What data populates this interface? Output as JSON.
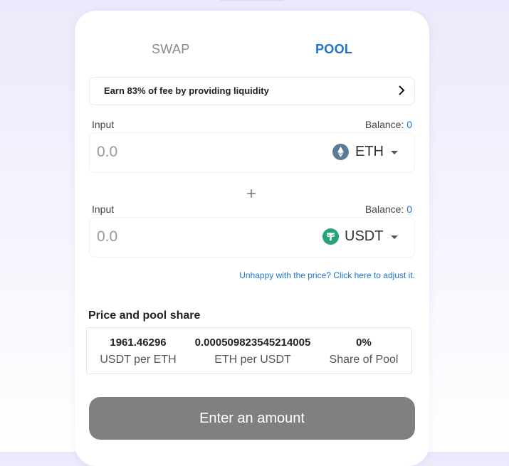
{
  "tabs": [
    {
      "label": "SWAP",
      "active": false
    },
    {
      "label": "POOL",
      "active": true
    }
  ],
  "promo": {
    "text": "Earn 83% of fee by providing liquidity"
  },
  "inputs": [
    {
      "label": "Input",
      "balance_label": "Balance:",
      "balance_value": "0",
      "placeholder": "0.0",
      "token": {
        "symbol": "ETH",
        "icon": "ethereum-icon",
        "color": "#627eea"
      }
    },
    {
      "label": "Input",
      "balance_label": "Balance:",
      "balance_value": "0",
      "placeholder": "0.0",
      "token": {
        "symbol": "USDT",
        "icon": "tether-icon",
        "color": "#26a17b"
      }
    }
  ],
  "adjust_link": "Unhappy with the price? Click here to adjust it.",
  "price_share": {
    "title": "Price and pool share",
    "items": [
      {
        "value": "1961.46296",
        "label": "USDT per ETH"
      },
      {
        "value": "0.000509823545214005",
        "label": "ETH per USDT"
      },
      {
        "value": "0%",
        "label": "Share of Pool"
      }
    ]
  },
  "action_button": {
    "label": "Enter an amount",
    "color": "#808080"
  },
  "colors": {
    "accent": "#1e73c8"
  }
}
